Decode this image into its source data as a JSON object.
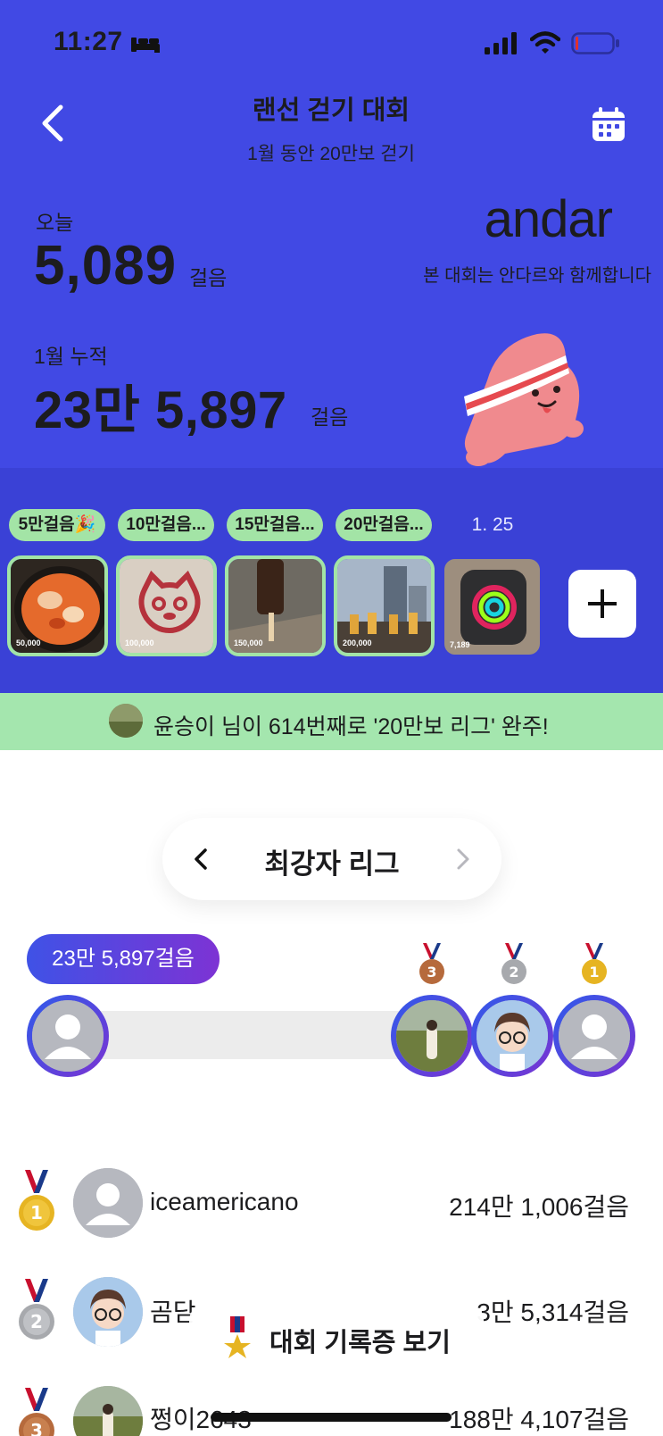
{
  "status_bar": {
    "time": "11:27"
  },
  "header": {
    "title": "랜선 걷기 대회",
    "subtitle": "1월 동안 20만보 걷기"
  },
  "stats": {
    "today_label": "오늘",
    "today_value": "5,089",
    "today_unit": "걸음",
    "month_label": "1월 누적",
    "month_value": "23만 5,897",
    "month_unit": "걸음"
  },
  "sponsor": {
    "logo_text": "andar",
    "note": "본 대회는 안다르와 함께합니다"
  },
  "milestones": [
    {
      "label": "5만걸음🎉",
      "thumb_steps": "50,000"
    },
    {
      "label": "10만걸음...",
      "thumb_steps": "100,000"
    },
    {
      "label": "15만걸음...",
      "thumb_steps": "150,000"
    },
    {
      "label": "20만걸음...",
      "thumb_steps": "200,000"
    }
  ],
  "latest": {
    "date": "1. 25",
    "thumb_steps": "7,189"
  },
  "banner": {
    "text": "윤승이 님이 614번째로 '20만보 리그' 완주!"
  },
  "league": {
    "title": "최강자 리그"
  },
  "progress": {
    "my_steps": "23만 5,897걸음"
  },
  "ranking": [
    {
      "rank": "1",
      "name": "iceamericano",
      "steps": "214만 1,006걸음"
    },
    {
      "rank": "2",
      "name": "곰닫",
      "steps": "3만 5,314걸음"
    },
    {
      "rank": "3",
      "name": "쩡이2643",
      "steps": "188만 4,107걸음"
    }
  ],
  "certificate": {
    "label": "대회 기록증 보기"
  },
  "colors": {
    "hero": "#4149e4",
    "milestone_bg": "#3a41d6",
    "milestone_chip": "#a3e4a6",
    "banner": "#a4e6ae",
    "gold": "#e6b422",
    "silver": "#a7a9ad",
    "bronze": "#b66a3c"
  }
}
